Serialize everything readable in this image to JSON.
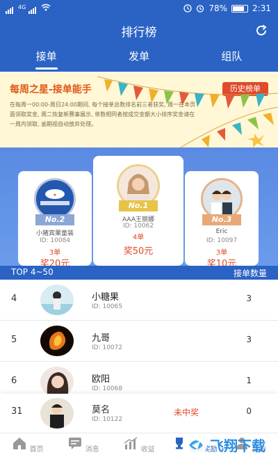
{
  "status_bar": {
    "network_label": "4G",
    "battery_text": "78%",
    "time": "2:31"
  },
  "header": {
    "title": "排行榜",
    "refresh_icon": "refresh-icon"
  },
  "tabs": [
    {
      "label": "接单",
      "active": true
    },
    {
      "label": "发单",
      "active": false
    },
    {
      "label": "组队",
      "active": false
    }
  ],
  "banner": {
    "title": "每周之星-接单能手",
    "history_button": "历史榜单",
    "text": "在每周一00:00-周日24:00期间, 每个接单总数排名前三者获奖, 周一在本页面领取奖金, 周二恢复新赛事展示, 单数相同者按成交金额大小排序奖金请在一周内领取, 逾期视自动放弃处理。"
  },
  "podium": [
    {
      "rank_label": "No.2",
      "name": "小猪宾果童装",
      "id_text": "ID: 10084",
      "count_text": "3单",
      "prize": "奖20元"
    },
    {
      "rank_label": "No.1",
      "name": "AAA王丽娜",
      "id_text": "ID: 10062",
      "count_text": "4单",
      "prize": "奖50元"
    },
    {
      "rank_label": "No.3",
      "name": "Eric",
      "id_text": "ID: 10097",
      "count_text": "3单",
      "prize": "奖10元"
    }
  ],
  "list_header": {
    "left": "TOP 4~50",
    "right": "接单数量"
  },
  "list": [
    {
      "rank": "4",
      "name": "小糖果",
      "id_text": "ID: 10065",
      "count": "3"
    },
    {
      "rank": "5",
      "name": "九哥",
      "id_text": "ID: 10072",
      "count": "3"
    },
    {
      "rank": "6",
      "name": "欧阳",
      "id_text": "ID: 10068",
      "count": "1"
    }
  ],
  "mine": {
    "rank": "31",
    "name": "莫名",
    "id_text": "ID: 10122",
    "status": "未中奖",
    "count": "0"
  },
  "bottom_nav": [
    {
      "label": "首页",
      "icon": "home-icon"
    },
    {
      "label": "消息",
      "icon": "message-icon"
    },
    {
      "label": "收益",
      "icon": "chart-icon"
    },
    {
      "label": "每周奖励",
      "icon": "trophy-icon"
    },
    {
      "label": "我的",
      "icon": "user-icon"
    }
  ],
  "watermark": "飞翔下载",
  "colors": {
    "primary": "#2a63c4",
    "accent": "#e04a2a",
    "banner_bg": "#fff7d6"
  }
}
